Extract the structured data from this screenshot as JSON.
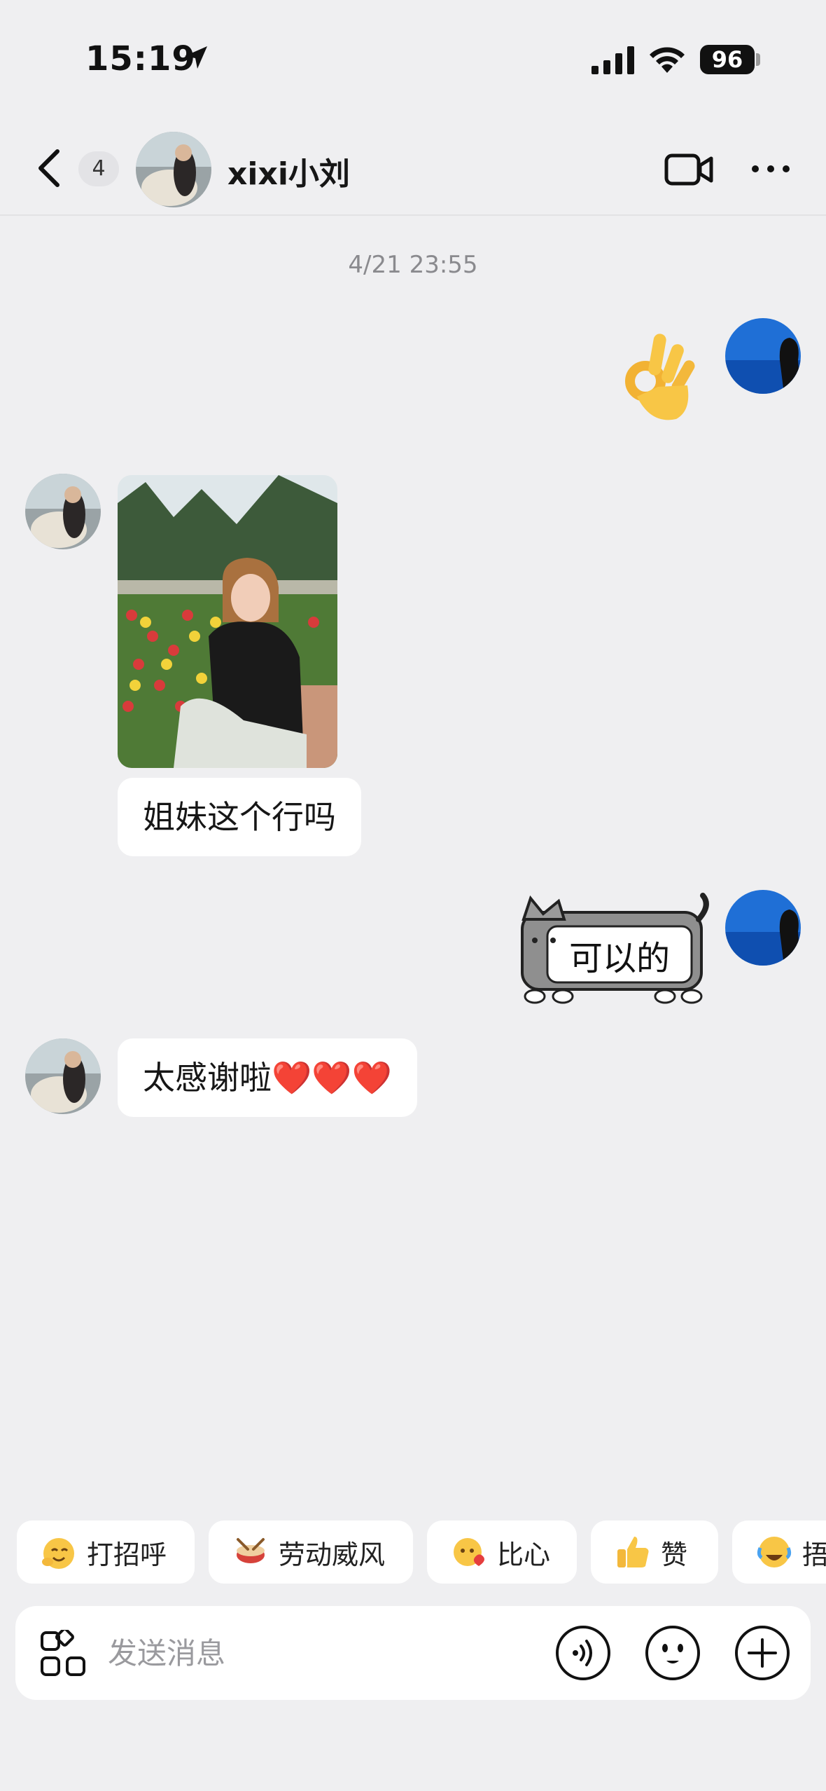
{
  "status_bar": {
    "time": "15:19",
    "battery": "96"
  },
  "header": {
    "back_label": "<",
    "unread_count": "4",
    "title": "xixi小刘"
  },
  "chat": {
    "timestamp": "4/21 23:55",
    "messages": [
      {
        "sender": "self",
        "type": "emoji",
        "content": "ok-hand"
      },
      {
        "sender": "friend",
        "type": "image",
        "content": "photo of a girl in tulip field"
      },
      {
        "sender": "friend",
        "type": "text",
        "content": "姐妹这个行吗"
      },
      {
        "sender": "self",
        "type": "sticker",
        "content": "可以的"
      },
      {
        "sender": "friend",
        "type": "text",
        "content": "太感谢啦❤️❤️❤️"
      }
    ]
  },
  "quick_replies": [
    {
      "label": "打招呼",
      "icon": "wave-face-icon"
    },
    {
      "label": "劳动威风",
      "icon": "drum-icon"
    },
    {
      "label": "比心",
      "icon": "heart-hands-icon"
    },
    {
      "label": "赞",
      "icon": "thumbs-up-icon"
    },
    {
      "label": "捂",
      "icon": "laugh-cry-icon"
    }
  ],
  "input": {
    "placeholder": "发送消息"
  },
  "colors": {
    "background": "#efeff1",
    "bubble": "#ffffff",
    "self_avatar": "#1f6fd6"
  }
}
